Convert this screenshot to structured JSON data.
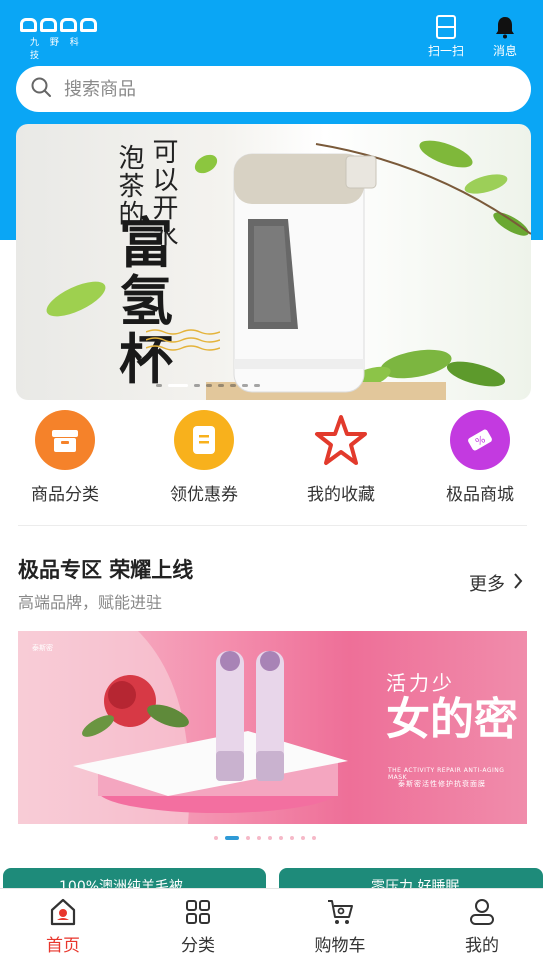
{
  "header": {
    "logo_text": "aapp",
    "logo_subtitle": "九 野 科 技",
    "scan_label": "扫一扫",
    "message_label": "消息"
  },
  "search": {
    "placeholder": "搜索商品"
  },
  "banner": {
    "line1": "可以开水",
    "line2": "泡茶的",
    "headline": "富氢杯",
    "slide_count": 8,
    "active_slide": 1
  },
  "quick_menu": [
    {
      "label": "商品分类",
      "icon": "box-icon",
      "color": "#f5822a"
    },
    {
      "label": "领优惠券",
      "icon": "coupon-icon",
      "color": "#f8b11c"
    },
    {
      "label": "我的收藏",
      "icon": "star-icon",
      "color": "#e23a2c"
    },
    {
      "label": "极品商城",
      "icon": "ticket-icon",
      "color": "#c33ae0"
    }
  ],
  "section": {
    "title": "极品专区 荣耀上线",
    "subtitle": "高端品牌，赋能进驻",
    "more_label": "更多"
  },
  "promo": {
    "title_line1": "活力少",
    "title_line2": "女的密",
    "en_text": "THE ACTIVITY REPAIR ANTI-AGING MASK",
    "cn_text": "泰斯密活性修护抗衰面膜",
    "brand": "泰斯密",
    "slide_count": 9,
    "active_slide": 1
  },
  "cards": [
    {
      "label": "100%澳洲纯羊毛被"
    },
    {
      "label": "零压力 好睡眠"
    }
  ],
  "nav": [
    {
      "label": "首页",
      "icon": "home-icon",
      "active": true
    },
    {
      "label": "分类",
      "icon": "grid-icon",
      "active": false
    },
    {
      "label": "购物车",
      "icon": "cart-icon",
      "active": false
    },
    {
      "label": "我的",
      "icon": "user-icon",
      "active": false
    }
  ],
  "colors": {
    "header_bg": "#0aa6f5",
    "nav_active": "#e8362c"
  }
}
